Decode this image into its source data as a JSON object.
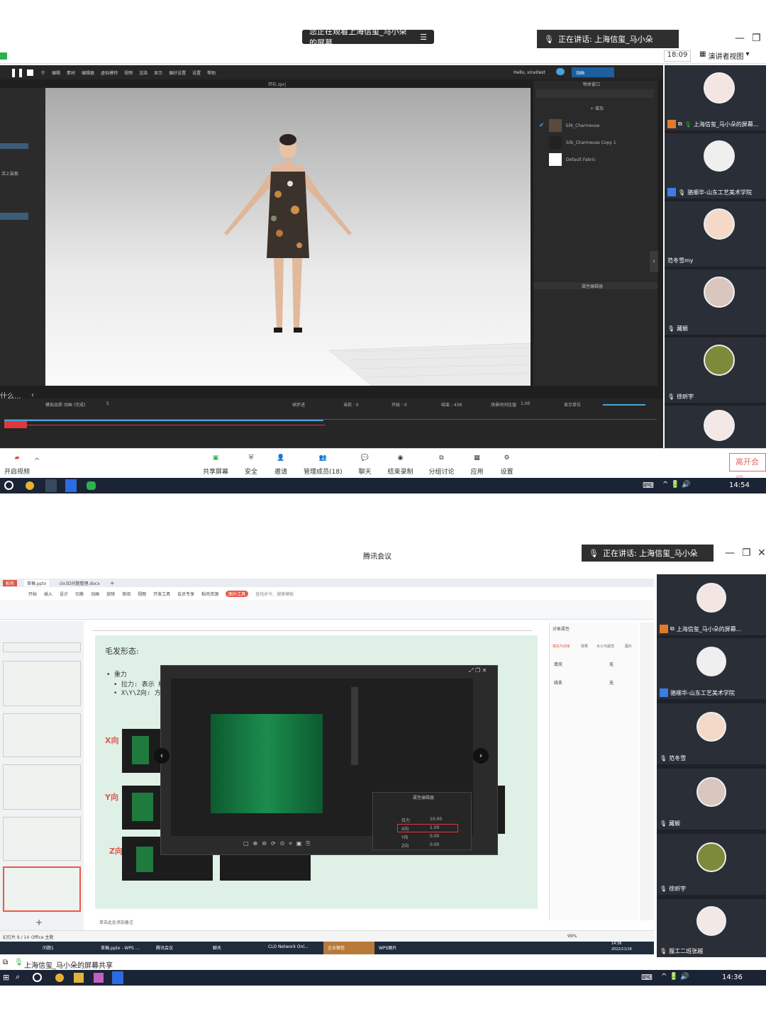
{
  "top": {
    "viewing_banner": "您正在观看上海信玺_马小朵的屏幕",
    "speaking": "正在讲话: 上海信玺_马小朵",
    "clock": "18:09",
    "view_mode": "演讲者视图",
    "clo": {
      "menus": [
        "文件",
        "编辑",
        "素材",
        "虚拟模特",
        "视频",
        "渲染",
        "显示",
        "偏好设置",
        "设置",
        "帮助"
      ],
      "menus_display": [
        "什",
        "编辑",
        "素材",
        "编辑器",
        "虚拟模特",
        "视频",
        "渲染",
        "显示",
        "偏好设置",
        "设置",
        "帮助"
      ],
      "hello": "Hello, xinxitest",
      "mode": "动画",
      "viewport_title": "开衫.zprj",
      "object_panel_title": "物体窗口",
      "add_label": "+ 增加",
      "fabrics": [
        "Silk_Charmeuse",
        "Silk_Charmeuse Copy 1",
        "Default Fabric"
      ],
      "property_title": "属性编辑器",
      "left_label": "活上装套",
      "left_bottom": "什么...",
      "timeline": {
        "record_label": "模拟品质 动画 (完成)",
        "fps": "5",
        "frame_label": "帧步进",
        "current": "当前 : 0",
        "start": "开始 : 0",
        "end": "结束 : 436",
        "speed_label": "场景时间比值",
        "speed": "1.00",
        "display_unit": "显示单位"
      }
    },
    "participants": [
      {
        "name": "上海信玺_马小朵的屏幕...",
        "color": "#f3e6e2"
      },
      {
        "name": "骆顺华-山东工艺美术学院",
        "color": "#efefef"
      },
      {
        "name": "范冬雪my",
        "color": "#f4d9c9"
      },
      {
        "name": "藏颖",
        "color": "#d9c6bf"
      },
      {
        "name": "徐昕宇",
        "color": "#7c8a3a"
      },
      {
        "name": "",
        "color": "#f2e8e6"
      }
    ],
    "toolbar": [
      "共享屏幕",
      "安全",
      "邀请",
      "管理成员(18)",
      "聊天",
      "结束录制",
      "分组讨论",
      "应用",
      "设置"
    ],
    "start_video": "开启视频",
    "leave": "离开会议",
    "taskbar_time": "14:54"
  },
  "bottom": {
    "title": "腾讯会议",
    "speaking": "正在讲话: 上海信玺_马小朵",
    "wps": {
      "tabs": [
        "稻壳",
        "草稿.pptx",
        "clo3D问题整理.docx"
      ],
      "ribbon_tabs": [
        "文件",
        "开始",
        "插入",
        "设计",
        "切换",
        "动画",
        "放映",
        "审阅",
        "视图",
        "开发工具",
        "会员专享",
        "稻壳资源",
        "图片工具"
      ],
      "search": "查找命令、搜索模板",
      "slide_heading": "毛发形态:",
      "bullet1": "• 重力",
      "bullet2": "• 拉力: 表示 梳理",
      "bullet3": "• X\\Y\\Z向: 方向",
      "labels": [
        "X向",
        "Y向",
        "Z向"
      ],
      "prop_panel": {
        "title": "属性编辑器",
        "rows": [
          [
            "拉力",
            "10.00"
          ],
          [
            "X向",
            "1.00"
          ],
          [
            "Y向",
            "0.00"
          ],
          [
            "Z向",
            "0.00"
          ]
        ]
      },
      "right_panel": {
        "title": "对象属性",
        "tabs": [
          "填充与线条",
          "效果",
          "大小与属性",
          "图片"
        ],
        "fill": "填充",
        "fill_val": "无",
        "line": "线条",
        "line_val": "无"
      },
      "notes": "单击此处添加备注",
      "status": [
        "幻灯片 9 / 14",
        "Office 主题"
      ],
      "zoom": "99%",
      "taskbar_items": [
        "问题1",
        "草稿.pptx - WPS ...",
        "腾讯会议",
        "聊天",
        "CLO Network Onl...",
        "企业微信",
        "WPS图片"
      ],
      "inner_time": "14:36",
      "inner_date": "2022/11/16"
    },
    "participants": [
      {
        "name": "上海信玺_马小朵的屏幕...",
        "color": "#f3e6e2"
      },
      {
        "name": "骆顺华-山东工艺美术学院",
        "color": "#efefef"
      },
      {
        "name": "范冬雪",
        "color": "#f4d9c9"
      },
      {
        "name": "藏颖",
        "color": "#d9c6bf"
      },
      {
        "name": "徐昕宇",
        "color": "#7c8a3a"
      },
      {
        "name": "服工二班张越",
        "color": "#f2e8e6"
      }
    ],
    "share_label": "上海信玺_马小朵的屏幕共享",
    "taskbar_time": "14:36"
  }
}
